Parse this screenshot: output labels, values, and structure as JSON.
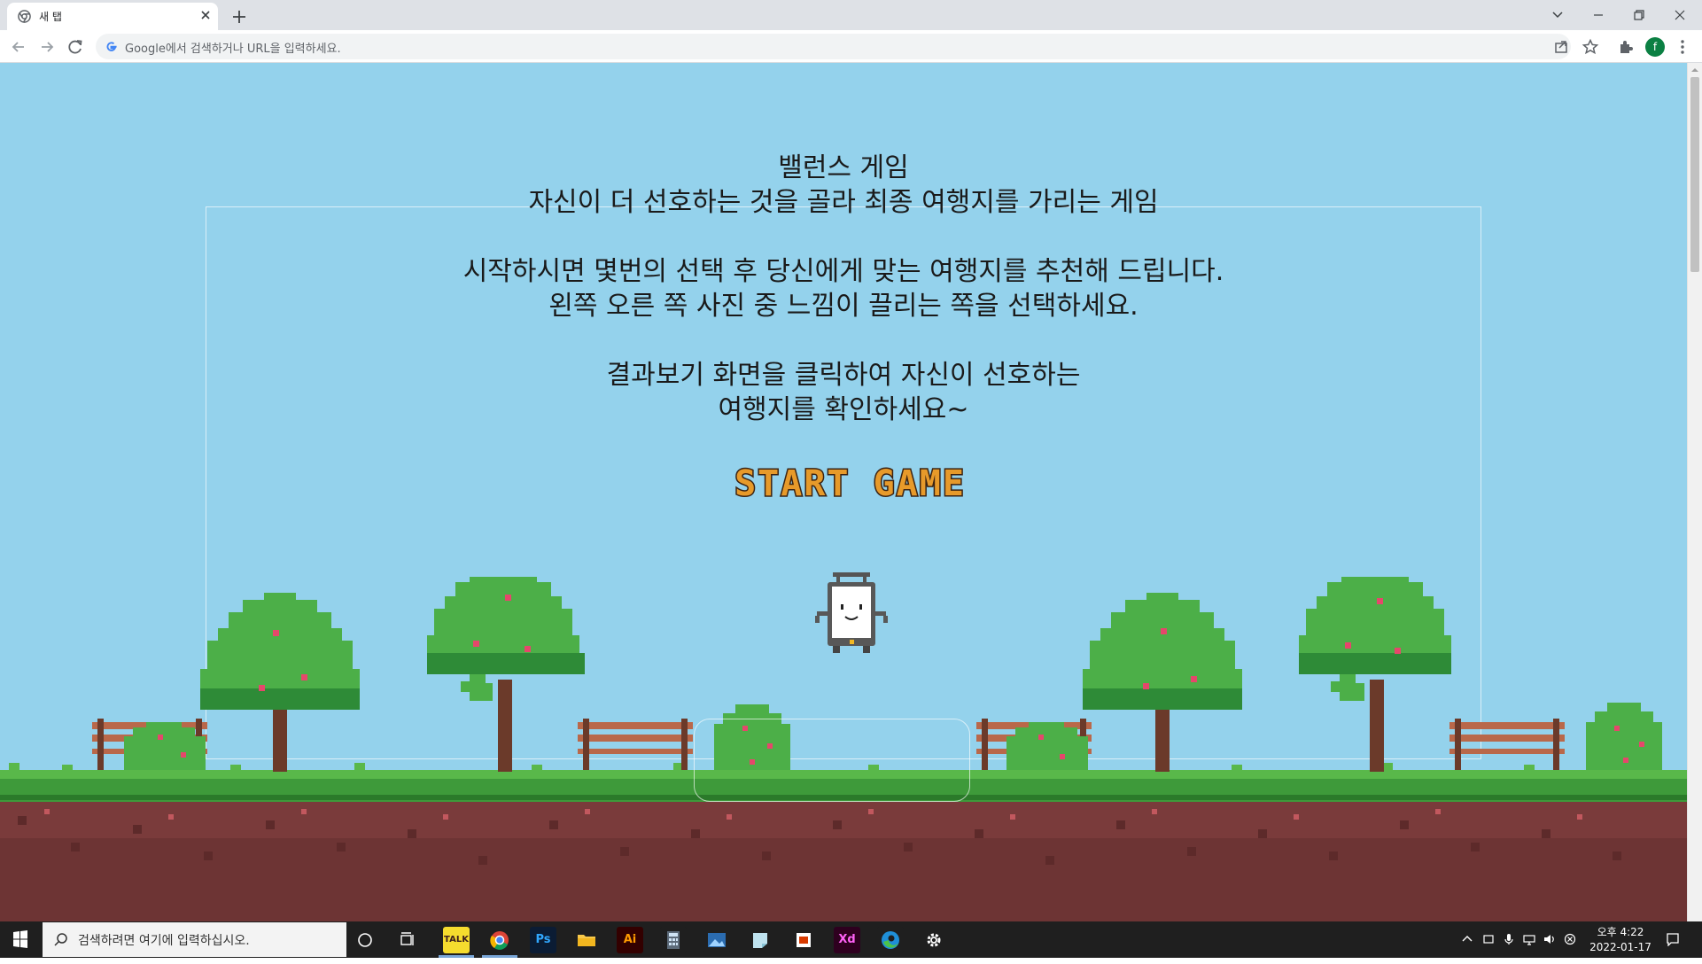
{
  "browser": {
    "tab_title": "새 탭",
    "new_tab_label": "+",
    "address_placeholder": "Google에서 검색하거나 URL을 입력하세요.",
    "profile_initial": "f"
  },
  "page": {
    "intro": {
      "title": "밸런스 게임",
      "subtitle": "자신이 더 선호하는 것을 골라 최종 여행지를 가리는 게임",
      "line_3": "시작하시면 몇번의 선택 후 당신에게 맞는 여행지를 추천해 드립니다.",
      "line_4": "왼쪽 오른 쪽 사진 중 느낌이 끌리는 쪽을 선택하세요.",
      "line_5": "결과보기 화면을 클릭하여 자신이 선호하는",
      "line_6": "여행지를 확인하세요~"
    },
    "start_button_label": "START GAME",
    "colors": {
      "sky": "#94d2ec",
      "grass": "#3e9a3a",
      "soil": "#7a3b3b",
      "start_text": "#e79a2a"
    }
  },
  "taskbar": {
    "search_placeholder": "검색하려면 여기에 입력하십시오.",
    "apps": [
      {
        "name": "kakaotalk",
        "label": "TALK",
        "bg": "#f5dc2e",
        "fg": "#3a1d1d"
      },
      {
        "name": "chrome",
        "label": "",
        "bg": "#1f1f1f",
        "fg": "#ffffff"
      },
      {
        "name": "photoshop",
        "label": "Ps",
        "bg": "#0b1c34",
        "fg": "#31a8ff"
      },
      {
        "name": "file-explorer",
        "label": "",
        "bg": "#1f1f1f",
        "fg": "#ffffff"
      },
      {
        "name": "illustrator",
        "label": "Ai",
        "bg": "#330000",
        "fg": "#ff9a00"
      },
      {
        "name": "calculator",
        "label": "",
        "bg": "#1f1f1f",
        "fg": "#ffffff"
      },
      {
        "name": "photos",
        "label": "",
        "bg": "#1f1f1f",
        "fg": "#ffffff"
      },
      {
        "name": "sticky-notes",
        "label": "",
        "bg": "#1f1f1f",
        "fg": "#ffffff"
      },
      {
        "name": "office",
        "label": "",
        "bg": "#1f1f1f",
        "fg": "#ffffff"
      },
      {
        "name": "adobe-xd",
        "label": "Xd",
        "bg": "#2e001f",
        "fg": "#ff61f6"
      },
      {
        "name": "edge",
        "label": "",
        "bg": "#1f1f1f",
        "fg": "#ffffff"
      },
      {
        "name": "settings",
        "label": "",
        "bg": "#1f1f1f",
        "fg": "#ffffff"
      }
    ],
    "clock_time": "오후 4:22",
    "clock_date": "2022-01-17"
  }
}
